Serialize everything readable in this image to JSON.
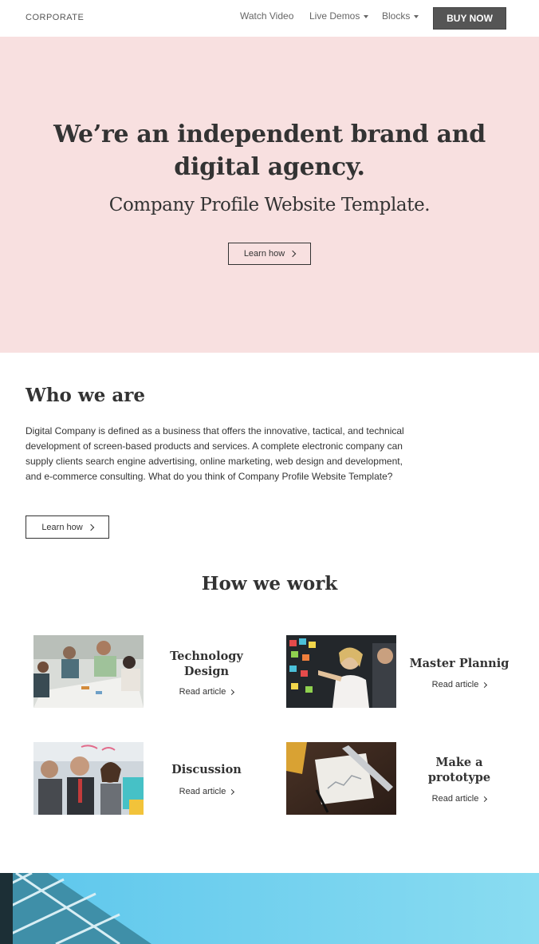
{
  "header": {
    "brand": "CORPORATE",
    "nav": [
      {
        "label": "Watch Video"
      },
      {
        "label": "Live Demos"
      },
      {
        "label": "Blocks"
      }
    ],
    "buy_label": "BUY NOW"
  },
  "hero": {
    "title_line1": "We’re an independent brand and",
    "title_line2": "digital agency.",
    "subtitle": "Company Profile Website Template.",
    "cta_label": "Learn how",
    "bg_color": "#f8e0e0"
  },
  "who": {
    "title": "Who we are",
    "text": "Digital Company is defined as a business that offers the innovative, tactical, and technical development of screen-based products and services. A complete electronic company can supply clients search engine advertising, online marketing, web design and development, and e-commerce consulting. What do you think of Company Profile Website Template?",
    "cta_label": "Learn how"
  },
  "how": {
    "title": "How we work",
    "cards": [
      {
        "title_line1": "Technology",
        "title_line2": "Design",
        "link": "Read article"
      },
      {
        "title_line1": "Master Plannig",
        "title_line2": "",
        "link": "Read article"
      },
      {
        "title_line1": "Discussion",
        "title_line2": "",
        "link": "Read article"
      },
      {
        "title_line1": "Make a",
        "title_line2": "prototype",
        "link": "Read article"
      }
    ]
  },
  "colors": {
    "accent_dark": "#555555",
    "hero_bg": "#f8e0e0",
    "banner_sky": "#7fd4ee"
  }
}
